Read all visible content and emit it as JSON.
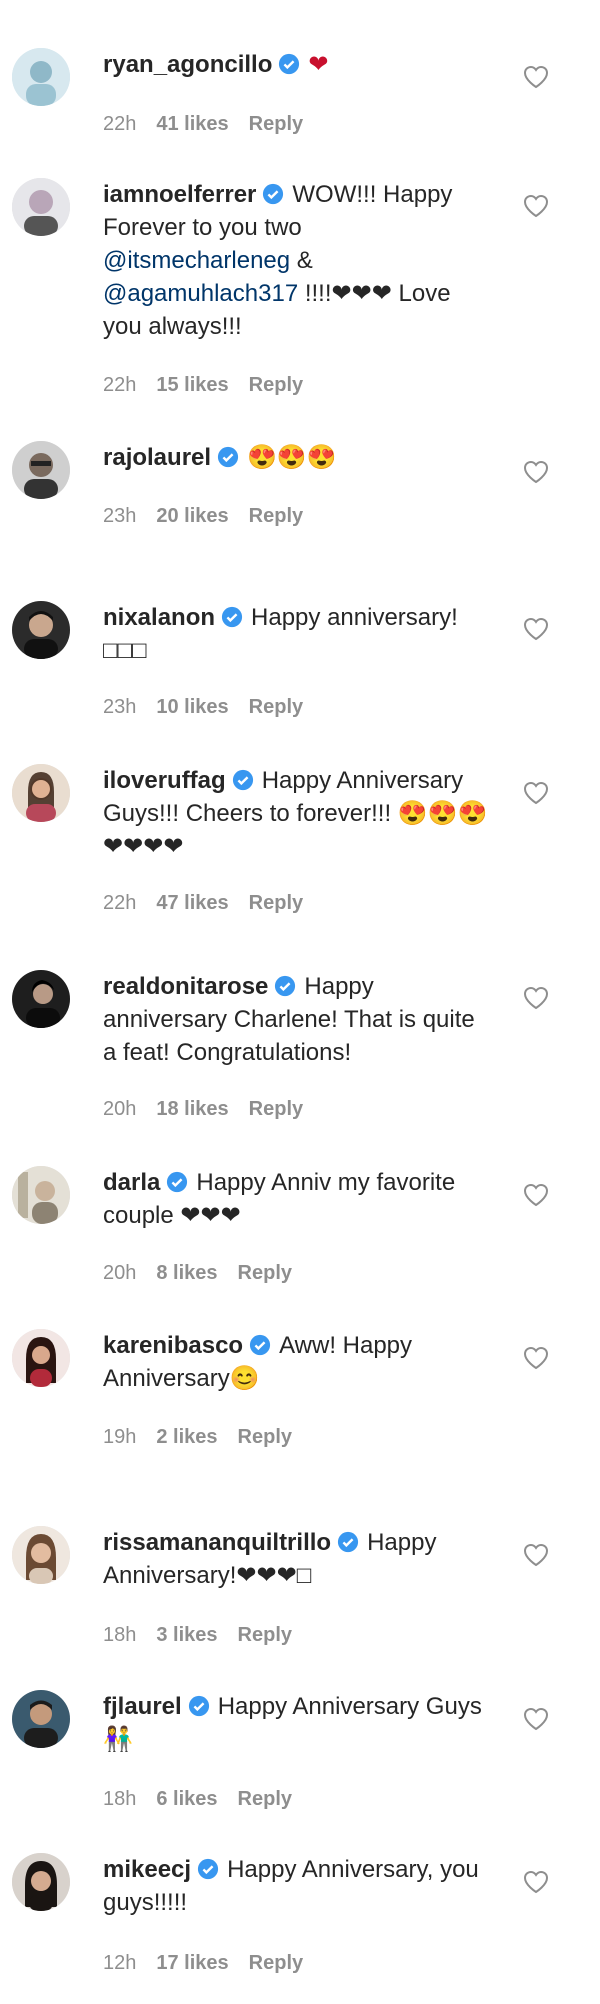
{
  "comments": [
    {
      "username": "ryan_agoncillo",
      "text": "❤",
      "time": "22h",
      "likes": "41 likes",
      "reply": "Reply"
    },
    {
      "username": "iamnoelferrer",
      "text_pre": "WOW!!! Happy Forever to you two ",
      "mention1": "@itsmecharleneg",
      "text_mid": " & ",
      "mention2": "@agamuhlach317",
      "text_post": " !!!!❤❤❤ Love you always!!!",
      "time": "22h",
      "likes": "15 likes",
      "reply": "Reply"
    },
    {
      "username": "rajolaurel",
      "text": "😍😍😍",
      "time": "23h",
      "likes": "20 likes",
      "reply": "Reply"
    },
    {
      "username": "nixalanon",
      "text": "Happy anniversary! □□□",
      "time": "23h",
      "likes": "10 likes",
      "reply": "Reply"
    },
    {
      "username": "iloveruffag",
      "text": "Happy Anniversary Guys!!! Cheers to forever!!! 😍😍😍 ❤❤❤❤",
      "time": "22h",
      "likes": "47 likes",
      "reply": "Reply"
    },
    {
      "username": "realdonitarose",
      "text": "Happy anniversary Charlene! That is quite a feat! Congratulations!",
      "time": "20h",
      "likes": "18 likes",
      "reply": "Reply"
    },
    {
      "username": "darla",
      "text": "Happy Anniv my favorite couple ❤❤❤",
      "time": "20h",
      "likes": "8 likes",
      "reply": "Reply"
    },
    {
      "username": "karenibasco",
      "text": "Aww! Happy Anniversary😊",
      "time": "19h",
      "likes": "2 likes",
      "reply": "Reply"
    },
    {
      "username": "rissamananquiltrillo",
      "text": "Happy Anniversary!❤❤❤□",
      "time": "18h",
      "likes": "3 likes",
      "reply": "Reply"
    },
    {
      "username": "fjlaurel",
      "text": "Happy Anniversary Guys 👫",
      "time": "18h",
      "likes": "6 likes",
      "reply": "Reply"
    },
    {
      "username": "mikeecj",
      "text": "Happy Anniversary, you guys!!!!!",
      "time": "12h",
      "likes": "17 likes",
      "reply": "Reply"
    }
  ],
  "colors": {
    "accent": "#3897f0",
    "heart": "#ed4956",
    "meta": "#8e8e8e",
    "text": "#262626"
  }
}
